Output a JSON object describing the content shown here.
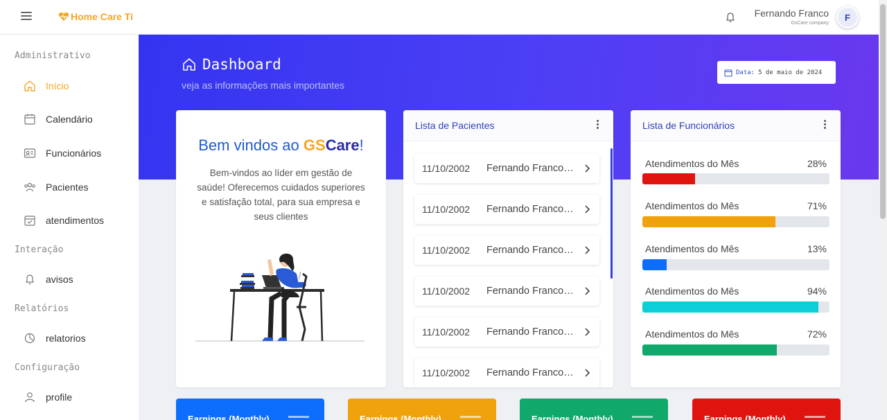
{
  "topbar": {
    "brand": "Home Care Ti",
    "user_name": "Fernando Franco",
    "user_company": "GsCare company",
    "avatar_initial": "F"
  },
  "sidebar": {
    "sections": [
      {
        "title": "Administrativo",
        "items": [
          {
            "label": "Início",
            "icon": "home-icon",
            "active": true
          },
          {
            "label": "Calendário",
            "icon": "calendar-icon"
          },
          {
            "label": "Funcionários",
            "icon": "id-card-icon"
          },
          {
            "label": "Pacientes",
            "icon": "users-icon"
          },
          {
            "label": "atendimentos",
            "icon": "calendar-check-icon"
          }
        ]
      },
      {
        "title": "Interação",
        "items": [
          {
            "label": "avisos",
            "icon": "bell-icon"
          }
        ]
      },
      {
        "title": "Relatórios",
        "items": [
          {
            "label": "relatorios",
            "icon": "chart-pie-icon"
          }
        ]
      },
      {
        "title": "Configuração",
        "items": [
          {
            "label": "profile",
            "icon": "user-icon"
          }
        ]
      }
    ]
  },
  "hero": {
    "title": "Dashboard",
    "subtitle": "veja as informações mais importantes",
    "date_label": "Data:",
    "date_value": "5 de maio de 2024"
  },
  "welcome": {
    "title_prefix": "Bem vindos ao ",
    "title_gs": "GS",
    "title_care": "Care",
    "title_suffix": "!",
    "text": "Bem-vindos ao líder em gestão de saúde! Oferecemos cuidados superiores e satisfação total, para sua empresa e seus clientes"
  },
  "patients": {
    "title": "Lista de Pacientes",
    "rows": [
      {
        "date": "11/10/2002",
        "name": "Fernando Franco Silva"
      },
      {
        "date": "11/10/2002",
        "name": "Fernando Franco Silva"
      },
      {
        "date": "11/10/2002",
        "name": "Fernando Franco Silva"
      },
      {
        "date": "11/10/2002",
        "name": "Fernando Franco Silva"
      },
      {
        "date": "11/10/2002",
        "name": "Fernando Franco Silva"
      },
      {
        "date": "11/10/2002",
        "name": "Fernando Franco Silva"
      }
    ]
  },
  "employees": {
    "title": "Lista de Funcionários",
    "rows": [
      {
        "label": "Atendimentos do Mês",
        "percent_text": "28%",
        "percent": 28,
        "color": "#e0140f"
      },
      {
        "label": "Atendimentos do Mês",
        "percent_text": "71%",
        "percent": 71,
        "color": "#f0a20c"
      },
      {
        "label": "Atendimentos do Mês",
        "percent_text": "13%",
        "percent": 13,
        "color": "#0d6efd"
      },
      {
        "label": "Atendimentos do Mês",
        "percent_text": "94%",
        "percent": 94,
        "color": "#0dcfd8"
      },
      {
        "label": "Atendimentos do Mês",
        "percent_text": "72%",
        "percent": 72,
        "color": "#10a96b"
      }
    ]
  },
  "stats": [
    {
      "label": "Earnings (Monthly)",
      "color": "#0d6efd"
    },
    {
      "label": "Earnings (Monthly)",
      "color": "#f0a20c"
    },
    {
      "label": "Earnings (Monthly)",
      "color": "#10a96b"
    },
    {
      "label": "Earnings (Monthly)",
      "color": "#e0140f"
    }
  ]
}
